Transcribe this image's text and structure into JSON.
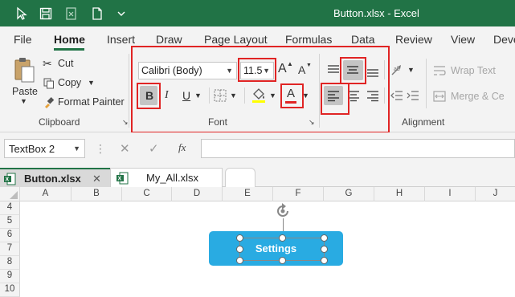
{
  "window": {
    "title": "Button.xlsx  -  Excel"
  },
  "menu": {
    "items": [
      "File",
      "Home",
      "Insert",
      "Draw",
      "Page Layout",
      "Formulas",
      "Data",
      "Review",
      "View",
      "Deve"
    ],
    "active": "Home"
  },
  "clipboard": {
    "paste_label": "Paste",
    "cut_label": "Cut",
    "copy_label": "Copy",
    "format_painter_label": "Format Painter",
    "group_label": "Clipboard"
  },
  "font": {
    "family": "Calibri (Body)",
    "size": "11.5",
    "bold_label": "B",
    "italic_label": "I",
    "underline_label": "U",
    "font_color_label": "A",
    "grow_label": "A",
    "shrink_label": "A",
    "group_label": "Font"
  },
  "alignment": {
    "wrap_text_label": "Wrap Text",
    "merge_label": "Merge & Ce",
    "group_label": "Alignment"
  },
  "formula_bar": {
    "name_box": "TextBox 2",
    "fx": "fx"
  },
  "tabs": [
    {
      "label": "Button.xlsx",
      "active": true
    },
    {
      "label": "My_All.xlsx",
      "active": false
    }
  ],
  "columns": [
    "A",
    "B",
    "C",
    "D",
    "E",
    "F",
    "G",
    "H",
    "I",
    "J"
  ],
  "rows": [
    "4",
    "5",
    "6",
    "7",
    "8",
    "9",
    "10"
  ],
  "shape": {
    "text": "Settings",
    "fill": "#29abe2"
  },
  "colors": {
    "excel_green": "#217346",
    "highlight_red": "#e02424",
    "font_color_bar": "#e02424",
    "fill_bar": "#ffff00"
  }
}
